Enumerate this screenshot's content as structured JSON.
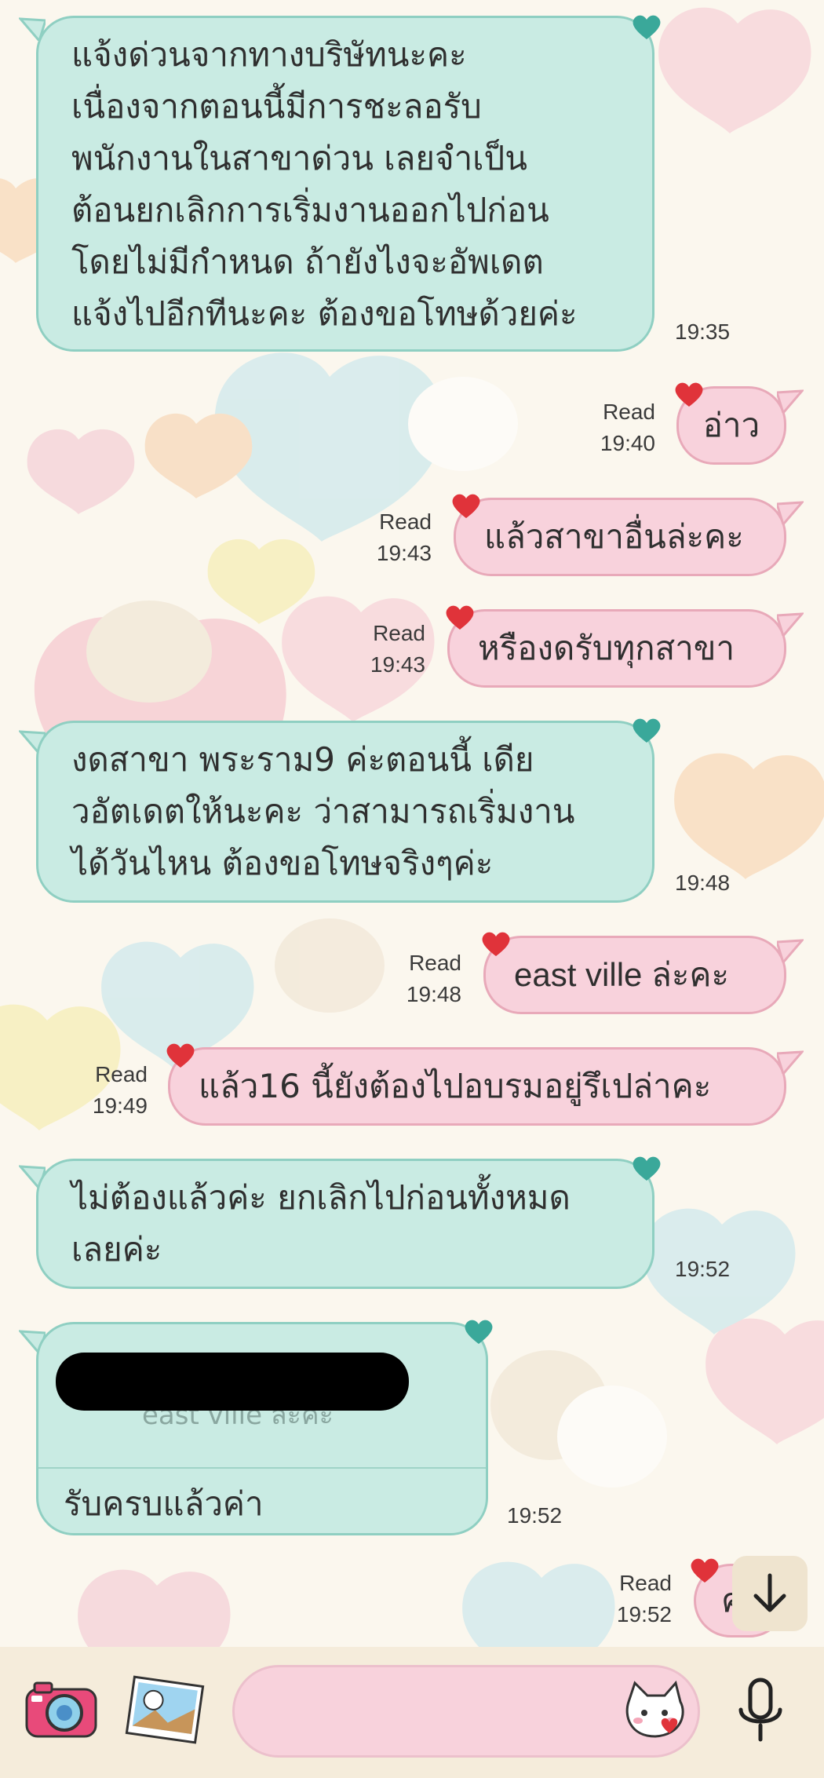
{
  "theme": {
    "incoming_bubble": "#c9ebe3",
    "outgoing_bubble": "#f8d2dc",
    "background": "#fbf7ee"
  },
  "messages": [
    {
      "direction": "incoming",
      "lines": [
        "แจ้งด่วนจากทางบริษัทนะคะ",
        "เนื่องจากตอนนี้มีการชะลอรับ",
        "พนักงานในสาขาด่วน เลยจำเป็น",
        "ต้อนยกเลิกการเริ่มงานออกไปก่อน",
        "โดยไม่มีกำหนด ถ้ายังไงจะอัพเดต",
        "แจ้งไปอีกทีนะคะ ต้องขอโทษด้วยค่ะ"
      ],
      "time": "19:35"
    },
    {
      "direction": "outgoing",
      "text": "อ่าว",
      "status": "Read",
      "time": "19:40"
    },
    {
      "direction": "outgoing",
      "text": "แล้วสาขาอื่นล่ะคะ",
      "status": "Read",
      "time": "19:43"
    },
    {
      "direction": "outgoing",
      "text": "หรืองดรับทุกสาขา",
      "status": "Read",
      "time": "19:43"
    },
    {
      "direction": "incoming",
      "lines": [
        "งดสาขา พระราม9 ค่ะตอนนี้  เดีย",
        "วอัตเดตให้นะคะ ว่าสามารถเริ่มงาน",
        "ได้วันไหน ต้องขอโทษจริงๆค่ะ"
      ],
      "time": "19:48"
    },
    {
      "direction": "outgoing",
      "text": "east ville ล่ะคะ",
      "status": "Read",
      "time": "19:48"
    },
    {
      "direction": "outgoing",
      "text": "แล้ว16 นี้ยังต้องไปอบรมอยู่รึเปล่าคะ",
      "status": "Read",
      "time": "19:49"
    },
    {
      "direction": "incoming",
      "lines": [
        "ไม่ต้องแล้วค่ะ ยกเลิกไปก่อนทั้งหมด",
        "เลยค่ะ"
      ],
      "time": "19:52"
    },
    {
      "direction": "incoming",
      "reply_quote": "east ville ล่ะคะ",
      "text": "รับครบแล้วค่า",
      "time": "19:52"
    },
    {
      "direction": "outgoing",
      "text": "ค",
      "status": "Read",
      "time": "19:52"
    }
  ],
  "input_bar": {
    "camera_icon": "camera-icon",
    "gallery_icon": "photo-gallery-icon",
    "sticker_icon": "cat-sticker-icon",
    "mic_icon": "microphone-icon"
  },
  "scroll_button_icon": "arrow-down-icon"
}
